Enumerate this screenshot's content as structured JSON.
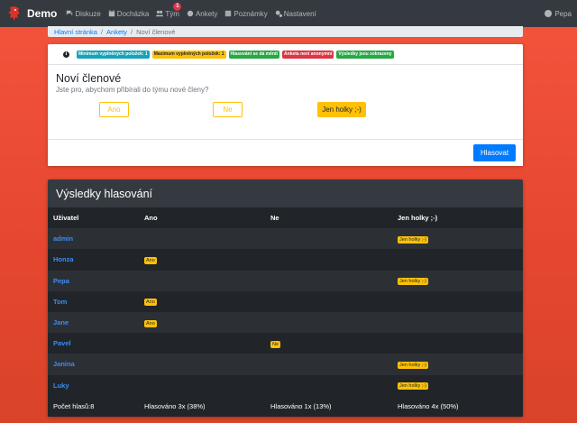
{
  "nav": {
    "brand": "Demo",
    "items": [
      {
        "label": "Diskuze",
        "icon": "comments-icon"
      },
      {
        "label": "Docházka",
        "icon": "calendar-icon"
      },
      {
        "label": "Tým",
        "icon": "users-icon",
        "badge": "1"
      },
      {
        "label": "Ankety",
        "icon": "poll-icon"
      },
      {
        "label": "Poznámky",
        "icon": "notes-icon"
      },
      {
        "label": "Nastavení",
        "icon": "cogs-icon"
      }
    ],
    "user": "Pepa"
  },
  "breadcrumb": {
    "items": [
      "Hlavní stránka",
      "Ankety"
    ],
    "active": "Noví členové"
  },
  "survey": {
    "pills": [
      {
        "label": "Minimum vyplněných položek: 1",
        "bg": "#17a2b8",
        "fg": "#ffffff"
      },
      {
        "label": "Maximum vyplněných položek: 1",
        "bg": "#ffc107",
        "fg": "#212529"
      },
      {
        "label": "Hlasování se dá měnit",
        "bg": "#28a745",
        "fg": "#ffffff"
      },
      {
        "label": "Anketa není anonymní",
        "bg": "#dc3545",
        "fg": "#ffffff"
      },
      {
        "label": "Výsledky jsou zobrazeny",
        "bg": "#28a745",
        "fg": "#ffffff"
      }
    ],
    "title": "Noví členové",
    "question": "Jste pro, abychom přibírali do týmu nové členy?",
    "options": [
      {
        "label": "Ano",
        "selected": false
      },
      {
        "label": "Ne",
        "selected": false
      },
      {
        "label": "Jen holky ;-)",
        "selected": true
      }
    ],
    "vote_label": "Hlasovat"
  },
  "results": {
    "title": "Výsledky hlasování",
    "headers": [
      "Uživatel",
      "Ano",
      "Ne",
      "Jen holky ;-)"
    ],
    "rows": [
      {
        "user": "admin",
        "vote": 2
      },
      {
        "user": "Honza",
        "vote": 0
      },
      {
        "user": "Pepa",
        "vote": 2
      },
      {
        "user": "Tom",
        "vote": 0
      },
      {
        "user": "Jane",
        "vote": 0
      },
      {
        "user": "Pavel",
        "vote": 1
      },
      {
        "user": "Janina",
        "vote": 2
      },
      {
        "user": "Luky",
        "vote": 2
      }
    ],
    "summary": [
      "Počet hlasů:8",
      "Hlasováno 3x (38%)",
      "Hlasováno 1x (13%)",
      "Hlasováno 4x (50%)"
    ]
  },
  "colors": {
    "accent": "#007bff",
    "warning": "#ffc107",
    "navbar": "#343a40"
  }
}
